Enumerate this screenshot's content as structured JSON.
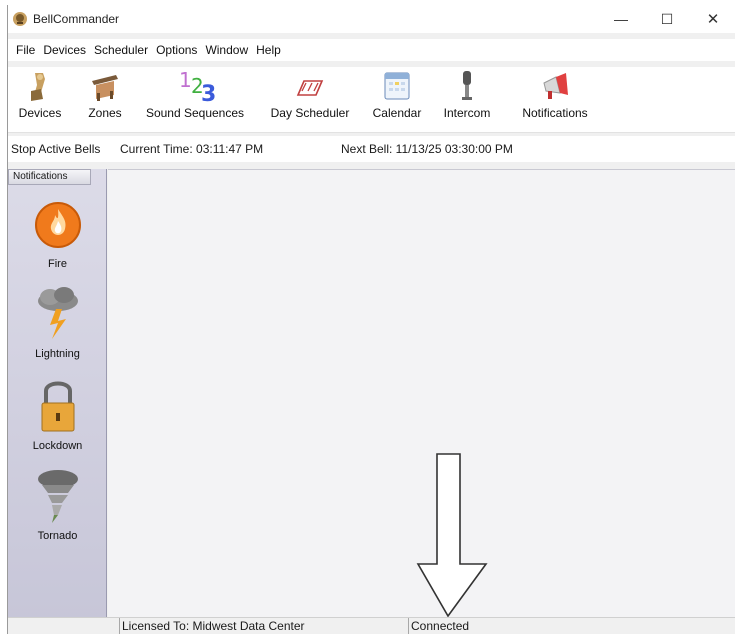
{
  "window": {
    "title": "BellCommander",
    "controls": {
      "minimize": "—",
      "maximize": "☐",
      "close": "✕"
    }
  },
  "menu": [
    "File",
    "Devices",
    "Scheduler",
    "Options",
    "Window",
    "Help"
  ],
  "toolbar": [
    {
      "label": "Devices",
      "icon": "devices-icon"
    },
    {
      "label": "Zones",
      "icon": "zones-icon"
    },
    {
      "label": "Sound Sequences",
      "icon": "sound-sequences-icon"
    },
    {
      "label": "Day Scheduler",
      "icon": "day-scheduler-icon"
    },
    {
      "label": "Calendar",
      "icon": "calendar-icon"
    },
    {
      "label": "Intercom",
      "icon": "intercom-icon"
    },
    {
      "label": "Notifications",
      "icon": "notifications-icon"
    }
  ],
  "status_strip": {
    "stop_bells": "Stop Active Bells",
    "current_time": "Current Time: 03:11:47 PM",
    "next_bell": "Next Bell: 11/13/25 03:30:00 PM"
  },
  "notifications_panel": {
    "header": "Notifications",
    "items": [
      {
        "label": "Fire",
        "icon": "fire-icon"
      },
      {
        "label": "Lightning",
        "icon": "lightning-icon"
      },
      {
        "label": "Lockdown",
        "icon": "lockdown-icon"
      },
      {
        "label": "Tornado",
        "icon": "tornado-icon"
      }
    ]
  },
  "bottom_bar": {
    "license": "Licensed To: Midwest Data Center",
    "connection": "Connected"
  },
  "colors": {
    "fire": "#f07a1c",
    "lock": "#e8a63a",
    "accent_blue": "#3b5bdb"
  }
}
